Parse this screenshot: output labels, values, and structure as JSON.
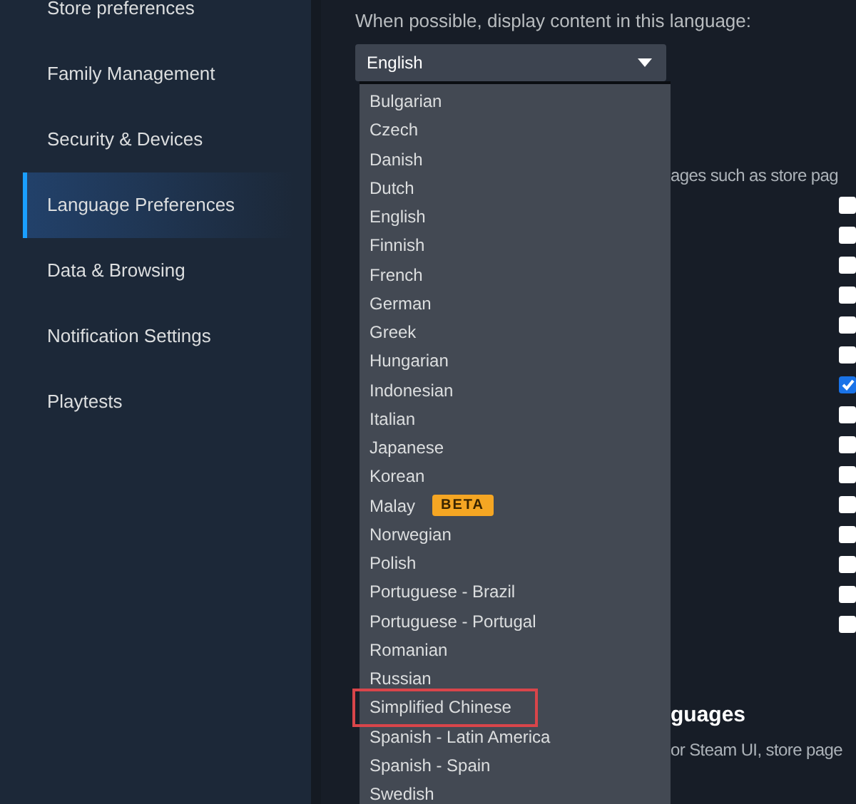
{
  "sidebar": {
    "items": [
      {
        "label": "Store preferences",
        "selected": false
      },
      {
        "label": "Family Management",
        "selected": false
      },
      {
        "label": "Security & Devices",
        "selected": false
      },
      {
        "label": "Language Preferences",
        "selected": true
      },
      {
        "label": "Data & Browsing",
        "selected": false
      },
      {
        "label": "Notification Settings",
        "selected": false
      },
      {
        "label": "Playtests",
        "selected": false
      }
    ]
  },
  "language": {
    "label": "When possible, display content in this language:",
    "value": "English",
    "dropdown": {
      "options": [
        {
          "label": "Bulgarian",
          "highlighted": false
        },
        {
          "label": "Czech",
          "highlighted": false
        },
        {
          "label": "Danish",
          "highlighted": false
        },
        {
          "label": "Dutch",
          "highlighted": false
        },
        {
          "label": "English",
          "highlighted": false
        },
        {
          "label": "Finnish",
          "highlighted": false
        },
        {
          "label": "French",
          "highlighted": false
        },
        {
          "label": "German",
          "highlighted": false
        },
        {
          "label": "Greek",
          "highlighted": false
        },
        {
          "label": "Hungarian",
          "highlighted": false
        },
        {
          "label": "Indonesian",
          "highlighted": false
        },
        {
          "label": "Italian",
          "highlighted": false
        },
        {
          "label": "Japanese",
          "highlighted": false
        },
        {
          "label": "Korean",
          "highlighted": false
        },
        {
          "label": "Malay",
          "badge": "BETA",
          "highlighted": false
        },
        {
          "label": "Norwegian",
          "highlighted": false
        },
        {
          "label": "Polish",
          "highlighted": false
        },
        {
          "label": "Portuguese - Brazil",
          "highlighted": false
        },
        {
          "label": "Portuguese - Portugal",
          "highlighted": false
        },
        {
          "label": "Romanian",
          "highlighted": false
        },
        {
          "label": "Russian",
          "highlighted": false
        },
        {
          "label": "Simplified Chinese",
          "highlighted": true
        },
        {
          "label": "Spanish - Latin America",
          "highlighted": false
        },
        {
          "label": "Spanish - Spain",
          "highlighted": false
        },
        {
          "label": "Swedish",
          "highlighted": false
        }
      ]
    }
  },
  "background": {
    "text_1": "ages such as store pag",
    "checkboxes": [
      {
        "checked": false
      },
      {
        "checked": false
      },
      {
        "checked": false
      },
      {
        "checked": false
      },
      {
        "checked": false
      },
      {
        "checked": false
      },
      {
        "checked": true
      },
      {
        "checked": false
      },
      {
        "checked": false
      },
      {
        "checked": false
      },
      {
        "checked": false
      },
      {
        "checked": false
      },
      {
        "checked": false
      },
      {
        "checked": false
      },
      {
        "checked": false
      }
    ],
    "heading": "guages",
    "text_2": "or Steam UI, store page"
  }
}
